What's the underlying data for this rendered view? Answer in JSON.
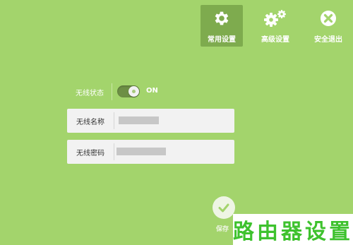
{
  "nav": {
    "items": [
      {
        "label": "常用设置",
        "icon": "gear-icon",
        "active": true
      },
      {
        "label": "高级设置",
        "icon": "gears-icon",
        "active": false
      },
      {
        "label": "安全退出",
        "icon": "close-circle-icon",
        "active": false
      }
    ]
  },
  "wireless": {
    "status_label": "无线状态",
    "status_value": "ON",
    "status_on": true,
    "name_label": "无线名称",
    "name_value": "",
    "password_label": "无线密码",
    "password_value": ""
  },
  "save": {
    "label": "保存",
    "icon": "check-circle-icon"
  },
  "watermark": {
    "text": "路由器设置"
  },
  "colors": {
    "background": "#a3d46c",
    "active_tab": "#7eab4e",
    "watermark": "#3ec22e"
  }
}
